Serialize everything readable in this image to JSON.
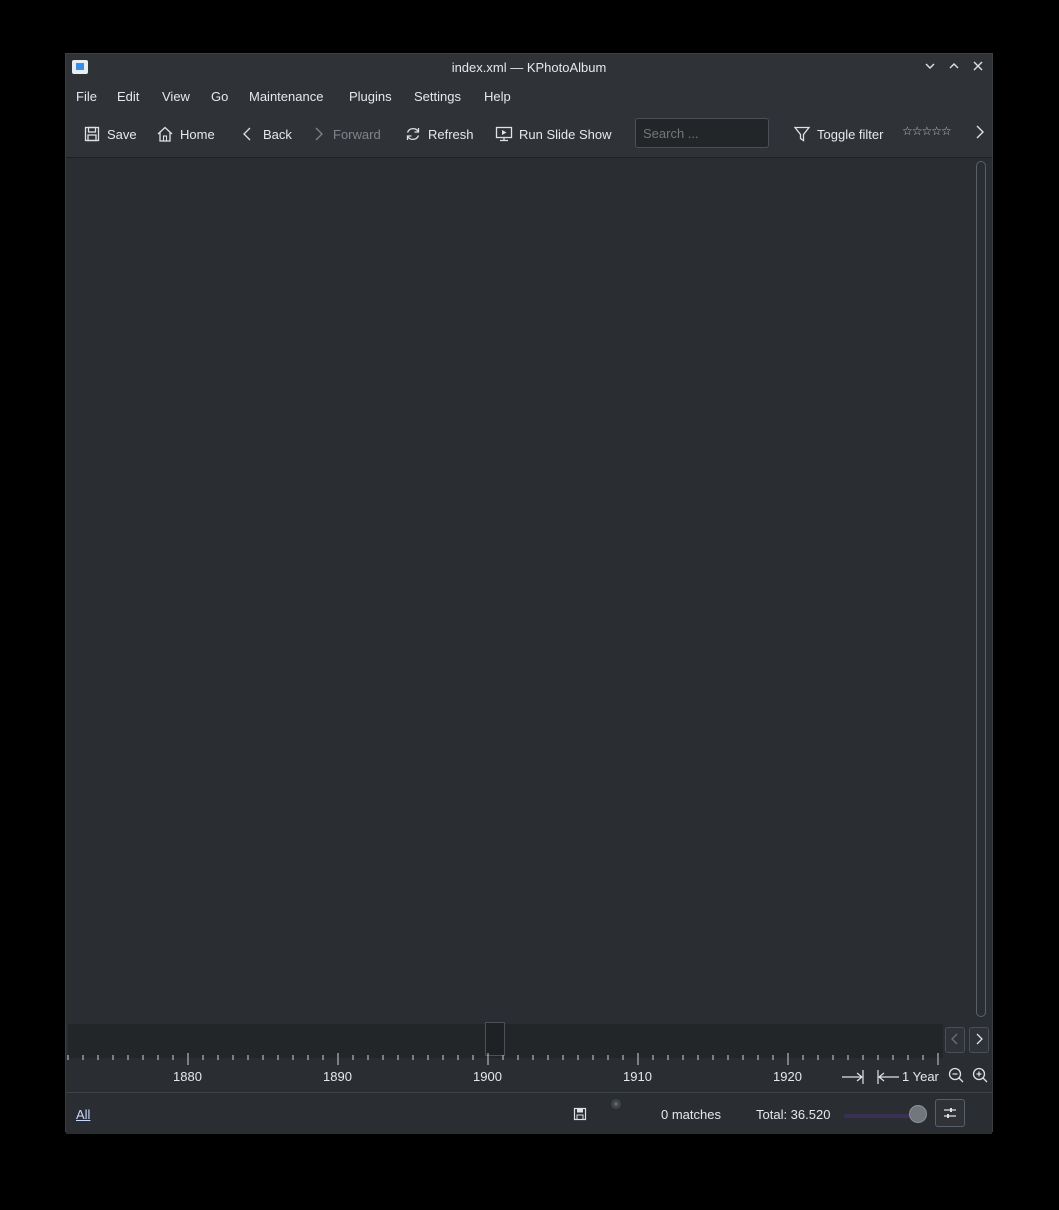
{
  "window": {
    "title": "index.xml — KPhotoAlbum"
  },
  "menubar": {
    "items": [
      "File",
      "Edit",
      "View",
      "Go",
      "Maintenance",
      "Plugins",
      "Settings",
      "Help"
    ]
  },
  "toolbar": {
    "save": "Save",
    "home": "Home",
    "back": "Back",
    "forward": "Forward",
    "refresh": "Refresh",
    "slideshow": "Run Slide Show",
    "search_placeholder": "Search ...",
    "toggle_filter": "Toggle filter",
    "rating_stars": "☆☆☆☆☆"
  },
  "timeline": {
    "years": [
      "1880",
      "1890",
      "1900",
      "1910",
      "1920"
    ],
    "unit_label": "1 Year"
  },
  "statusbar": {
    "all_link": "All",
    "matches": "0 matches",
    "total": "Total: 36.520",
    "thumbnail_slider_level": 0.92
  },
  "colors": {
    "accent": "#3daee9",
    "slider_track": "#3b2f55",
    "background": "#2a2e32"
  }
}
